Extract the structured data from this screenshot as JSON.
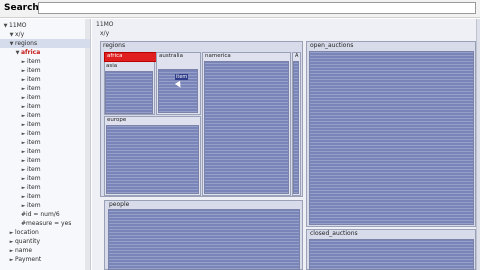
{
  "search": {
    "label": "Search",
    "value": ""
  },
  "tree": {
    "rows": [
      {
        "label": "11MO",
        "indent": 0,
        "arrow": "▼"
      },
      {
        "label": "x/y",
        "indent": 1,
        "arrow": "▼"
      },
      {
        "label": "regions",
        "indent": 1,
        "arrow": "▼",
        "selected": true
      },
      {
        "label": "africa",
        "indent": 2,
        "arrow": "▼",
        "red": true
      },
      {
        "label": "item",
        "indent": 3,
        "arrow": "►"
      },
      {
        "label": "item",
        "indent": 3,
        "arrow": "►"
      },
      {
        "label": "item",
        "indent": 3,
        "arrow": "►"
      },
      {
        "label": "item",
        "indent": 3,
        "arrow": "►"
      },
      {
        "label": "item",
        "indent": 3,
        "arrow": "►"
      },
      {
        "label": "item",
        "indent": 3,
        "arrow": "►"
      },
      {
        "label": "item",
        "indent": 3,
        "arrow": "►"
      },
      {
        "label": "item",
        "indent": 3,
        "arrow": "►"
      },
      {
        "label": "item",
        "indent": 3,
        "arrow": "►"
      },
      {
        "label": "item",
        "indent": 3,
        "arrow": "►"
      },
      {
        "label": "item",
        "indent": 3,
        "arrow": "►"
      },
      {
        "label": "item",
        "indent": 3,
        "arrow": "►"
      },
      {
        "label": "item",
        "indent": 3,
        "arrow": "►"
      },
      {
        "label": "item",
        "indent": 3,
        "arrow": "►"
      },
      {
        "label": "item",
        "indent": 3,
        "arrow": "►"
      },
      {
        "label": "item",
        "indent": 3,
        "arrow": "►"
      },
      {
        "label": "item",
        "indent": 3,
        "arrow": "►"
      },
      {
        "label": "#id = num/6",
        "indent": 2,
        "arrow": ""
      },
      {
        "label": "#measure = yes",
        "indent": 2,
        "arrow": ""
      },
      {
        "label": "location",
        "indent": 1,
        "arrow": "►"
      },
      {
        "label": "quantity",
        "indent": 1,
        "arrow": "►"
      },
      {
        "label": "name",
        "indent": 1,
        "arrow": "►"
      },
      {
        "label": "Payment",
        "indent": 1,
        "arrow": "►"
      }
    ]
  },
  "main": {
    "breadcrumb": "11MO",
    "sub": "x/y",
    "regions_title": "regions",
    "africa": "africa",
    "asia": "asia",
    "australia": "australia",
    "namerica": "namerica",
    "europe": "europe",
    "samerica": "A",
    "people": "people",
    "open_auctions": "open_auctions",
    "closed_auctions": "closed_auctions",
    "item_label": "item"
  }
}
